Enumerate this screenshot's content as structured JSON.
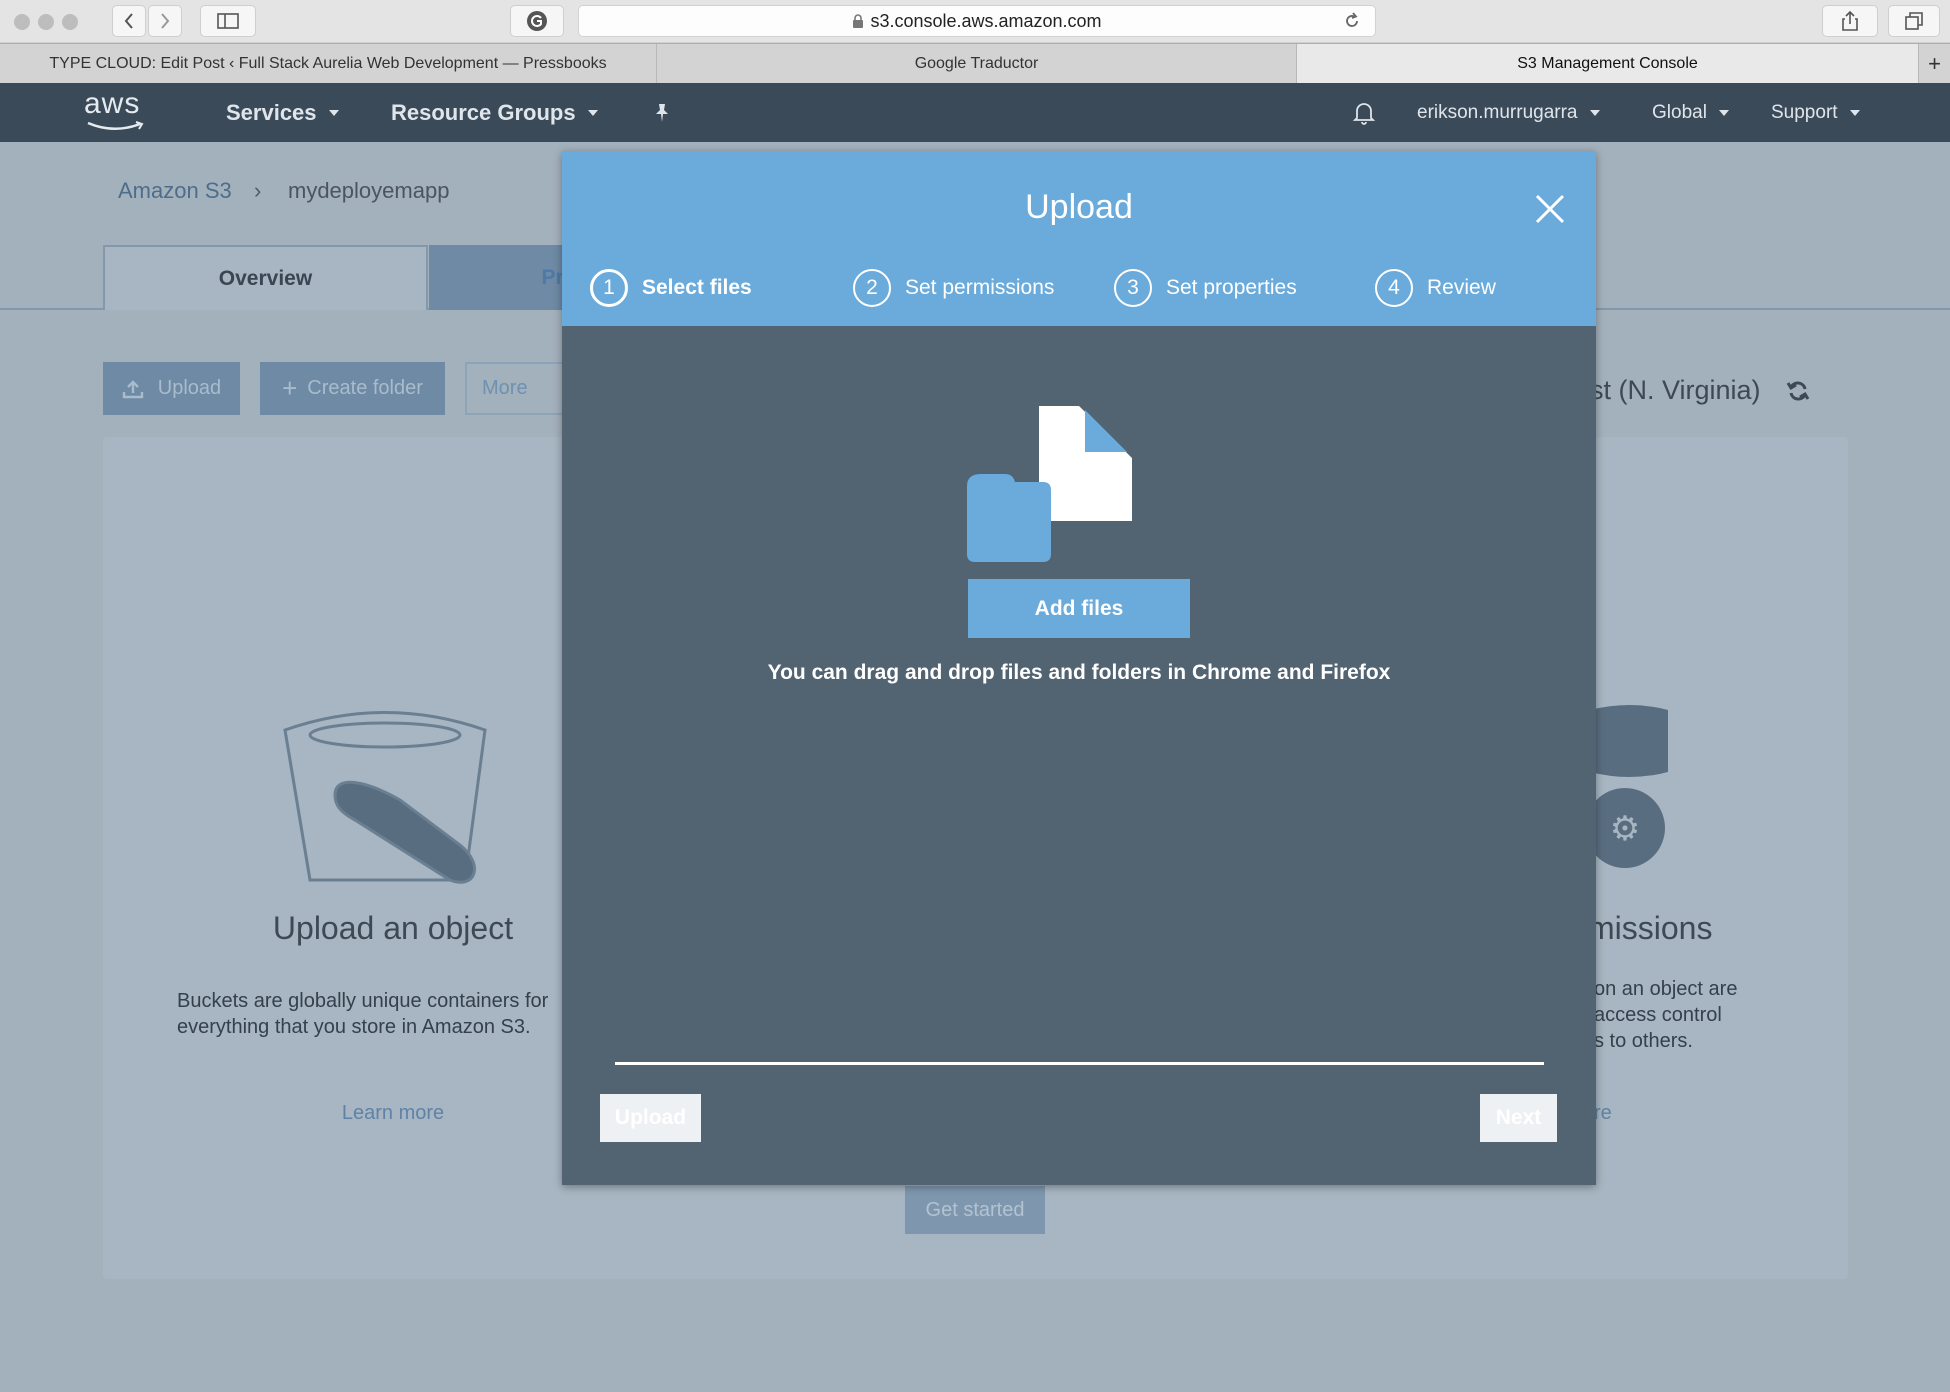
{
  "browser": {
    "url": "s3.console.aws.amazon.com",
    "tabs": [
      {
        "label": "TYPE CLOUD: Edit Post ‹ Full Stack Aurelia Web Development — Pressbooks"
      },
      {
        "label": "Google Traductor"
      },
      {
        "label": "S3 Management Console"
      }
    ],
    "new_tab": "+"
  },
  "nav": {
    "logo": "aws",
    "services": "Services",
    "resource_groups": "Resource Groups",
    "user": "erikson.murrugarra",
    "region": "Global",
    "support": "Support"
  },
  "page": {
    "breadcrumb_root": "Amazon S3",
    "breadcrumb_sep": "›",
    "breadcrumb_current": "mydeployemapp",
    "tab_overview": "Overview",
    "tab_properties": "Pro",
    "upload_btn": "Upload",
    "create_folder_btn": "Create folder",
    "more_btn": "More",
    "region_text": "st (N. Virginia)",
    "card_left_title": "Upload an object",
    "card_left_desc_1": "Buckets are globally unique containers for",
    "card_left_desc_2": "everything that you store in Amazon S3.",
    "card_left_link": "Learn more",
    "card_right_title": "missions",
    "card_right_desc_1": "on an object are",
    "card_right_desc_2": "access control",
    "card_right_desc_3": "s to others.",
    "card_right_link": "re",
    "get_started": "Get started"
  },
  "modal": {
    "title": "Upload",
    "steps": [
      {
        "num": "1",
        "label": "Select files"
      },
      {
        "num": "2",
        "label": "Set permissions"
      },
      {
        "num": "3",
        "label": "Set properties"
      },
      {
        "num": "4",
        "label": "Review"
      }
    ],
    "add_files": "Add files",
    "hint": "You can drag and drop files and folders in Chrome and Firefox",
    "upload_btn": "Upload",
    "next_btn": "Next"
  },
  "colors": {
    "nav_bg": "#3b4a59",
    "modal_header": "#6aabdc",
    "modal_body": "#526372",
    "overlay": "#a3b1bd"
  }
}
